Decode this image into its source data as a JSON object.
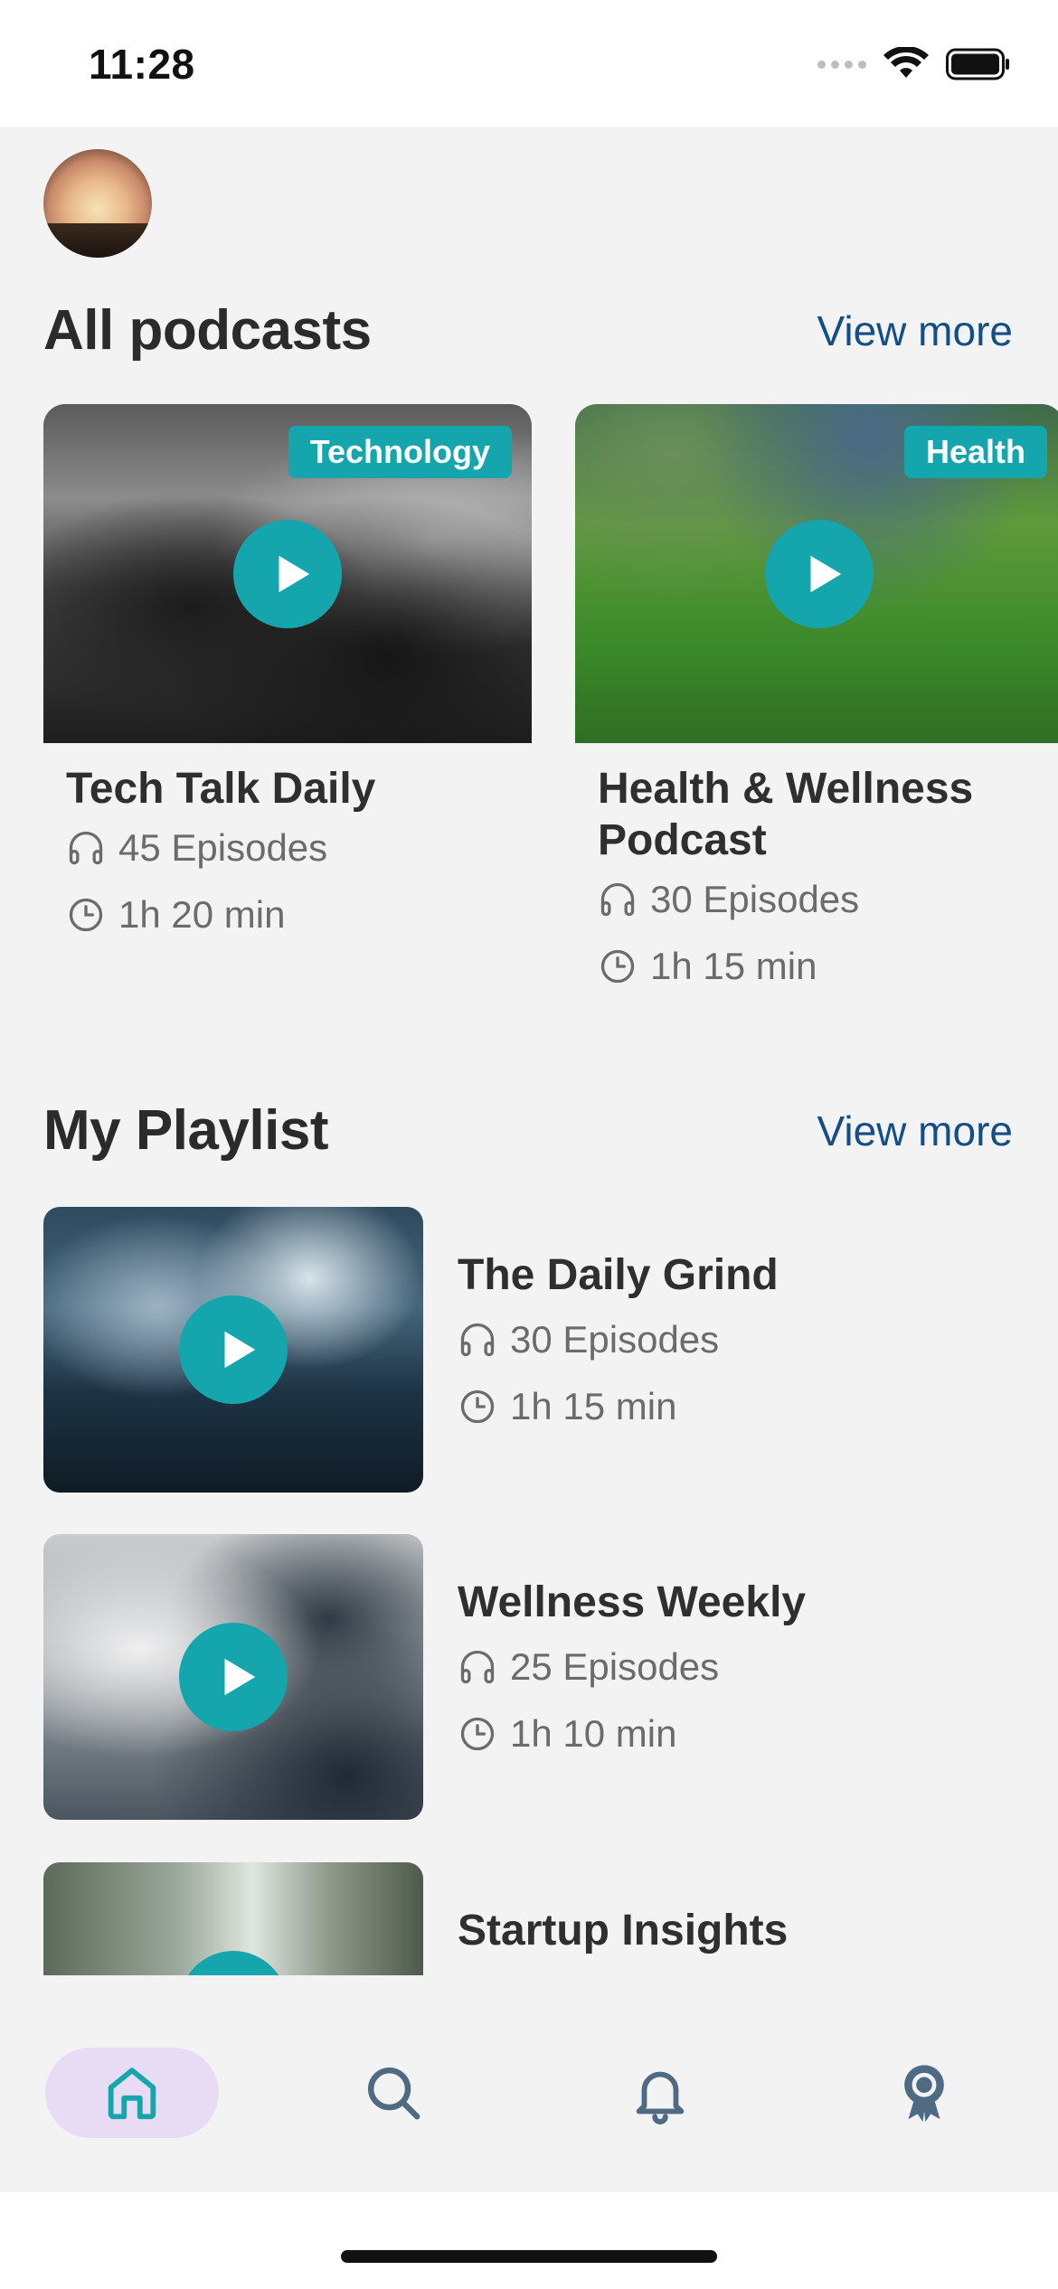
{
  "status_bar": {
    "time": "11:28"
  },
  "all_podcasts": {
    "title": "All podcasts",
    "view_more": "View more",
    "cards": [
      {
        "title": "Tech Talk Daily",
        "tag": "Technology",
        "episodes": "45 Episodes",
        "duration": "1h 20 min"
      },
      {
        "title": "Health & Wellness Podcast",
        "tag": "Health",
        "episodes": "30 Episodes",
        "duration": "1h 15 min"
      }
    ]
  },
  "my_playlist": {
    "title": "My Playlist",
    "view_more": "View more",
    "items": [
      {
        "title": "The Daily Grind",
        "episodes": "30 Episodes",
        "duration": "1h 15 min"
      },
      {
        "title": "Wellness Weekly",
        "episodes": "25 Episodes",
        "duration": "1h 10 min"
      },
      {
        "title": "Startup Insights"
      }
    ]
  },
  "bottom_nav": {
    "items": [
      {
        "icon": "home-icon",
        "active": true
      },
      {
        "icon": "search-icon",
        "active": false
      },
      {
        "icon": "bell-icon",
        "active": false
      },
      {
        "icon": "award-icon",
        "active": false
      }
    ]
  },
  "colors": {
    "accent": "#14a5ad",
    "link": "#134f86",
    "nav_active_bg": "#e8dcf5",
    "background": "#f3f3f4"
  }
}
